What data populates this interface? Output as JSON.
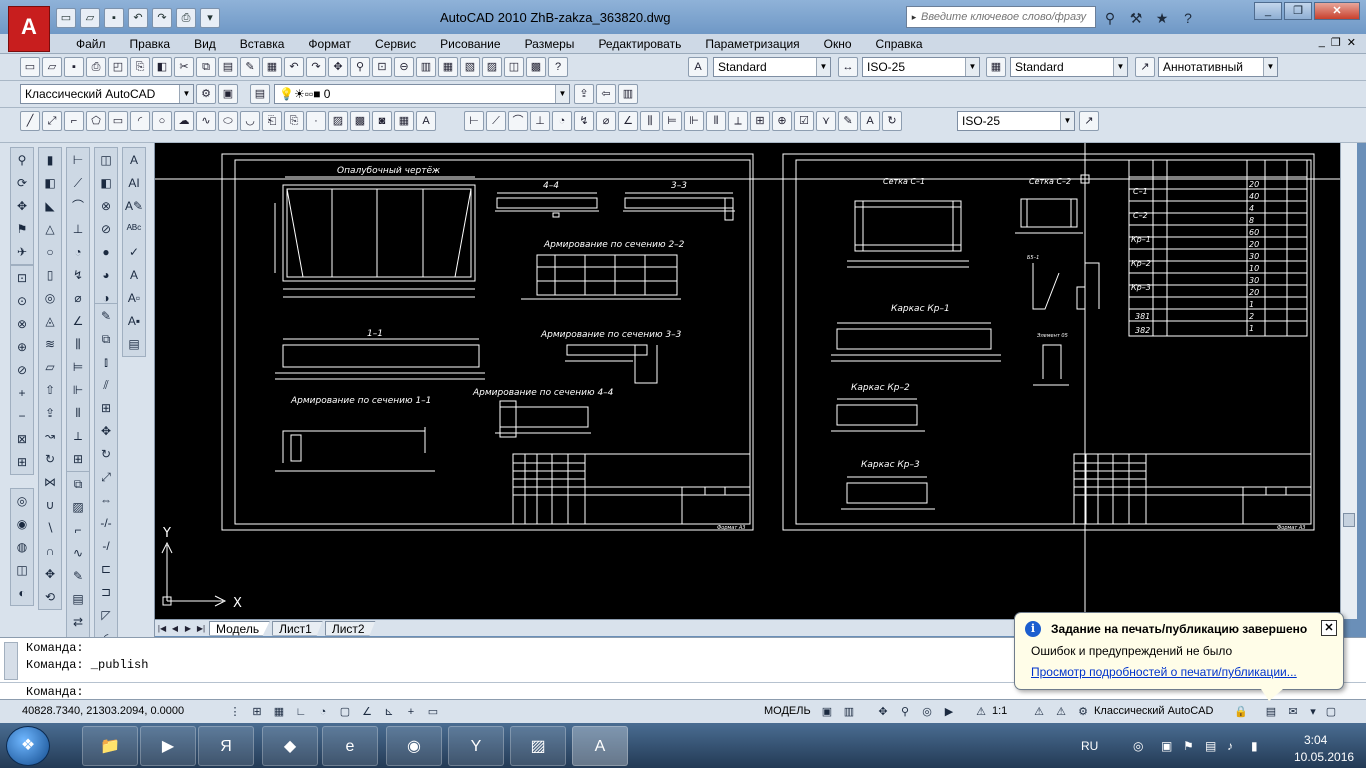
{
  "window": {
    "title": "AutoCAD 2010      ZhB-zakza_363820.dwg",
    "app_logo": "A",
    "search_placeholder": "Введите ключевое слово/фразу"
  },
  "menu": [
    "Файл",
    "Правка",
    "Вид",
    "Вставка",
    "Формат",
    "Сервис",
    "Рисование",
    "Размеры",
    "Редактировать",
    "Параметризация",
    "Окно",
    "Справка"
  ],
  "toolbars": {
    "text_style": "Standard",
    "dim_style": "ISO-25",
    "table_style": "Standard",
    "multileader_style": "Аннотативный",
    "workspace": "Классический AutoCAD",
    "layer": "0",
    "dim_style_2": "ISO-25"
  },
  "drawing": {
    "sheet1_titles": {
      "formwork": "Опалубочный чертёж",
      "sec_4_4": "4–4",
      "sec_3_3": "3–3",
      "arm_2_2": "Армирование по сечению 2–2",
      "sec_1_1": "1–1",
      "arm_3_3": "Армирование по сечению 3–3",
      "arm_1_1": "Армирование по сечению 1–1",
      "arm_4_4": "Армирование по сечению 4–4"
    },
    "sheet2_titles": {
      "grid_c1": "Сетка С–1",
      "grid_c2": "Сетка С–2",
      "frame_kr1": "Каркас Кр–1",
      "frame_kr2": "Каркас Кр–2",
      "frame_kr3": "Каркас Кр–3",
      "detail": "Элемент 05",
      "section_b": "Б5–1"
    },
    "format_label": "Формат А3",
    "spec_rows": [
      "С–1",
      "С–2",
      "Кр–1",
      "Кр–2",
      "Кр–3",
      "381",
      "382"
    ],
    "spec_qty": [
      "20",
      "40",
      "4",
      "8",
      "60",
      "20",
      "30",
      "10",
      "30",
      "20",
      "1",
      "2",
      "1"
    ],
    "axis_y": "Y",
    "axis_x": "X"
  },
  "tabs": {
    "model": "Модель",
    "layout1": "Лист1",
    "layout2": "Лист2"
  },
  "command": {
    "history": [
      "Команда:",
      "Команда: _publish"
    ],
    "prompt": "Команда:",
    "input_value": ""
  },
  "balloon": {
    "title": "Задание на печать/публикацию завершено",
    "message": "Ошибок и предупреждений не было",
    "link": "Просмотр подробностей о печати/публикации...",
    "info_glyph": "i",
    "close_glyph": "✕"
  },
  "status": {
    "coords": "40828.7340, 21303.2094, 0.0000",
    "model": "МОДЕЛЬ",
    "scale": "1:1",
    "workspace": "Классический AutoCAD"
  },
  "taskbar": {
    "lang": "RU",
    "time": "3:04",
    "date": "10.05.2016"
  },
  "colors": {
    "canvas": "#000000",
    "lines": "#ffffff",
    "link": "#0033cc",
    "balloon_bg": "#fffde8"
  }
}
